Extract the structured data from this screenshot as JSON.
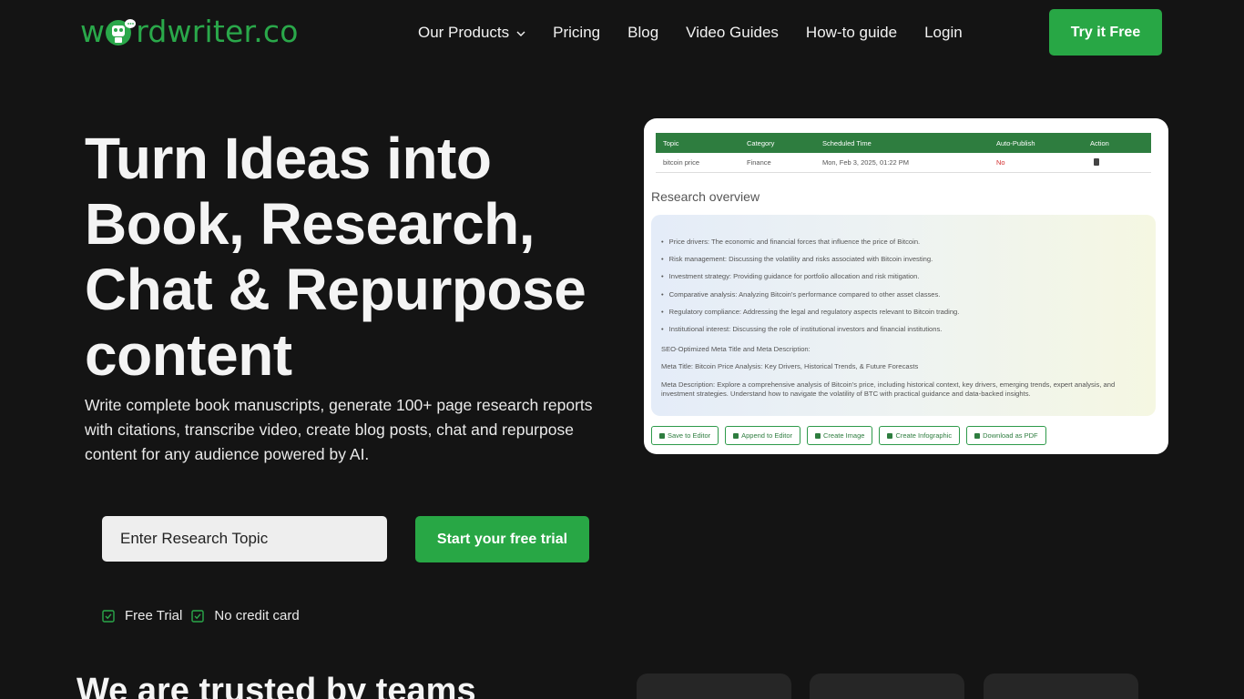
{
  "brand": {
    "logo_prefix": "w",
    "logo_suffix": "rdwriter.co",
    "accent": "#28a745",
    "background": "#141414"
  },
  "nav": {
    "items": [
      {
        "label": "Our Products",
        "has_dropdown": true
      },
      {
        "label": "Pricing"
      },
      {
        "label": "Blog"
      },
      {
        "label": "Video Guides"
      },
      {
        "label": "How-to guide"
      },
      {
        "label": "Login"
      }
    ],
    "cta": "Try it Free"
  },
  "hero": {
    "title_lines": [
      "Turn Ideas into",
      "Book, Research,",
      "Chat & Repurpose",
      "content"
    ],
    "subtitle": "Write complete book manuscripts, generate 100+ page research reports with citations, transcribe video, create blog posts, chat and repurpose content for any audience powered by AI.",
    "search_placeholder": "Enter Research Topic",
    "trial_button": "Start your free trial",
    "checks": [
      "Free Trial",
      "No credit card"
    ]
  },
  "preview": {
    "table": {
      "headers": [
        "Topic",
        "Category",
        "Scheduled Time",
        "Auto-Publish",
        "Action"
      ],
      "row": [
        "bitcoin price",
        "Finance",
        "Mon, Feb 3, 2025, 01:22 PM",
        "No"
      ]
    },
    "overview_title": "Research overview",
    "bullets": [
      "Price drivers: The economic and financial forces that influence the price of Bitcoin.",
      "Risk management: Discussing the volatility and risks associated with Bitcoin investing.",
      "Investment strategy: Providing guidance for portfolio allocation and risk mitigation.",
      "Comparative analysis: Analyzing Bitcoin's performance compared to other asset classes.",
      "Regulatory compliance: Addressing the legal and regulatory aspects relevant to Bitcoin trading.",
      "Institutional interest: Discussing the role of institutional investors and financial institutions."
    ],
    "seo_heading": "SEO-Optimized Meta Title and Meta Description:",
    "meta_title": "Meta Title: Bitcoin Price Analysis: Key Drivers, Historical Trends, & Future Forecasts",
    "meta_description": "Meta Description: Explore a comprehensive analysis of Bitcoin's price, including historical context, key drivers, emerging trends, expert analysis, and investment strategies. Understand how to navigate the volatility of BTC with practical guidance and data-backed insights.",
    "buttons": [
      "Save to Editor",
      "Append to Editor",
      "Create Image",
      "Create Infographic",
      "Download as PDF"
    ]
  },
  "trusted_heading": "We are trusted by teams"
}
